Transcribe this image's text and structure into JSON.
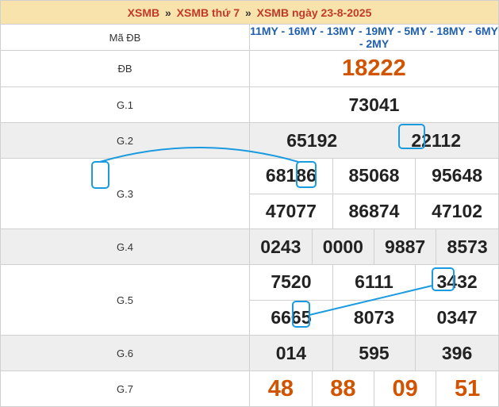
{
  "header": {
    "crumb1": "XSMB",
    "sep": "»",
    "crumb2": "XSMB thứ 7",
    "crumb3": "XSMB ngày 23-8-2025"
  },
  "code_row": {
    "label": "Mã ĐB",
    "value": "11MY - 16MY - 13MY - 19MY - 5MY - 18MY - 6MY - 2MY"
  },
  "prizes": {
    "db": {
      "label": "ĐB",
      "values": [
        "18222"
      ]
    },
    "g1": {
      "label": "G.1",
      "values": [
        "73041"
      ]
    },
    "g2": {
      "label": "G.2",
      "values": [
        "65192",
        "22112"
      ]
    },
    "g3": {
      "label": "G.3",
      "values": [
        "68186",
        "85068",
        "95648",
        "47077",
        "86874",
        "47102"
      ]
    },
    "g4": {
      "label": "G.4",
      "values": [
        "0243",
        "0000",
        "9887",
        "8573"
      ]
    },
    "g5": {
      "label": "G.5",
      "values": [
        "7520",
        "6111",
        "3432",
        "6665",
        "8073",
        "0347"
      ]
    },
    "g6": {
      "label": "G.6",
      "values": [
        "014",
        "595",
        "396"
      ]
    },
    "g7": {
      "label": "G.7",
      "values": [
        "48",
        "88",
        "09",
        "51"
      ]
    }
  },
  "colors": {
    "header_bg": "#f9e3ad",
    "accent_red": "#d35400",
    "code_blue": "#1f5fae",
    "marker_blue": "#1a9be0"
  }
}
